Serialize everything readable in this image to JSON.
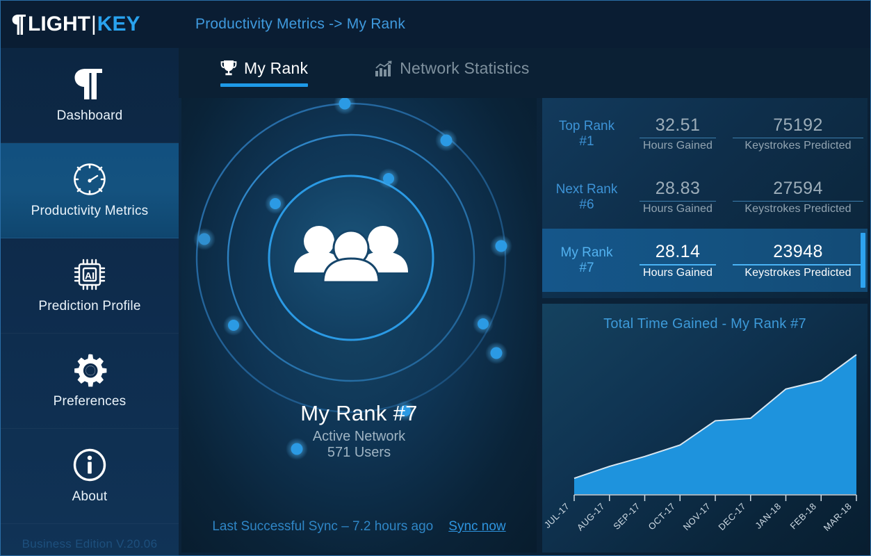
{
  "app": {
    "logo_light": "LIGHT",
    "logo_slash": "|",
    "logo_key": "KEY",
    "edition": "Business Edition V.20.06",
    "accent": "#1e9ae8",
    "accent_light": "#2ea3ef",
    "link_color": "#2e95e0"
  },
  "sidebar": {
    "items": [
      {
        "label": "Dashboard",
        "icon": "pilcrow-l-icon",
        "active": false
      },
      {
        "label": "Productivity Metrics",
        "icon": "gauge-icon",
        "active": true
      },
      {
        "label": "Prediction Profile",
        "icon": "ai-chip-icon",
        "active": false
      },
      {
        "label": "Preferences",
        "icon": "gear-icon",
        "active": false
      },
      {
        "label": "About",
        "icon": "info-icon",
        "active": false
      }
    ]
  },
  "header": {
    "breadcrumb": "Productivity Metrics -> My Rank"
  },
  "tabs": [
    {
      "label": "My Rank",
      "icon": "trophy-icon",
      "active": true
    },
    {
      "label": "Network Statistics",
      "icon": "bar-chart-icon",
      "active": false
    }
  ],
  "network": {
    "center_title": "My Rank #7",
    "center_sub1": "Active Network",
    "center_sub2": "571 Users",
    "users_count": "571",
    "icon": "users-group-icon"
  },
  "sync": {
    "status_text": "Last Successful Sync – 7.2 hours ago",
    "action_label": "Sync now"
  },
  "ranks": {
    "columns": [
      "Hours Gained",
      "Keystrokes Predicted"
    ],
    "rows": [
      {
        "name": "Top Rank",
        "rank": "#1",
        "hours_gained": "32.51",
        "hours_caption": "Hours Gained",
        "keystrokes": "75192",
        "keystrokes_caption": "Keystrokes Predicted",
        "highlight": false
      },
      {
        "name": "Next Rank",
        "rank": "#6",
        "hours_gained": "28.83",
        "hours_caption": "Hours Gained",
        "keystrokes": "27594",
        "keystrokes_caption": "Keystrokes Predicted",
        "highlight": false
      },
      {
        "name": "My Rank",
        "rank": "#7",
        "hours_gained": "28.14",
        "hours_caption": "Hours Gained",
        "keystrokes": "23948",
        "keystrokes_caption": "Keystrokes Predicted",
        "highlight": true
      }
    ]
  },
  "chart_data": {
    "type": "area",
    "title": "Total Time Gained - My Rank #7",
    "xlabel": "",
    "ylabel": "",
    "categories": [
      "JUL-17",
      "AUG-17",
      "SEP-17",
      "OCT-17",
      "NOV-17",
      "DEC-17",
      "JAN-18",
      "FEB-18",
      "MAR-18"
    ],
    "values": [
      3.2,
      5.6,
      7.6,
      9.9,
      14.8,
      15.3,
      21.2,
      22.9,
      28.14
    ],
    "ylim": [
      0,
      30
    ],
    "grid": false,
    "legend": "none",
    "series_color": "#1e93dd",
    "line_color": "#d8e6f0"
  }
}
